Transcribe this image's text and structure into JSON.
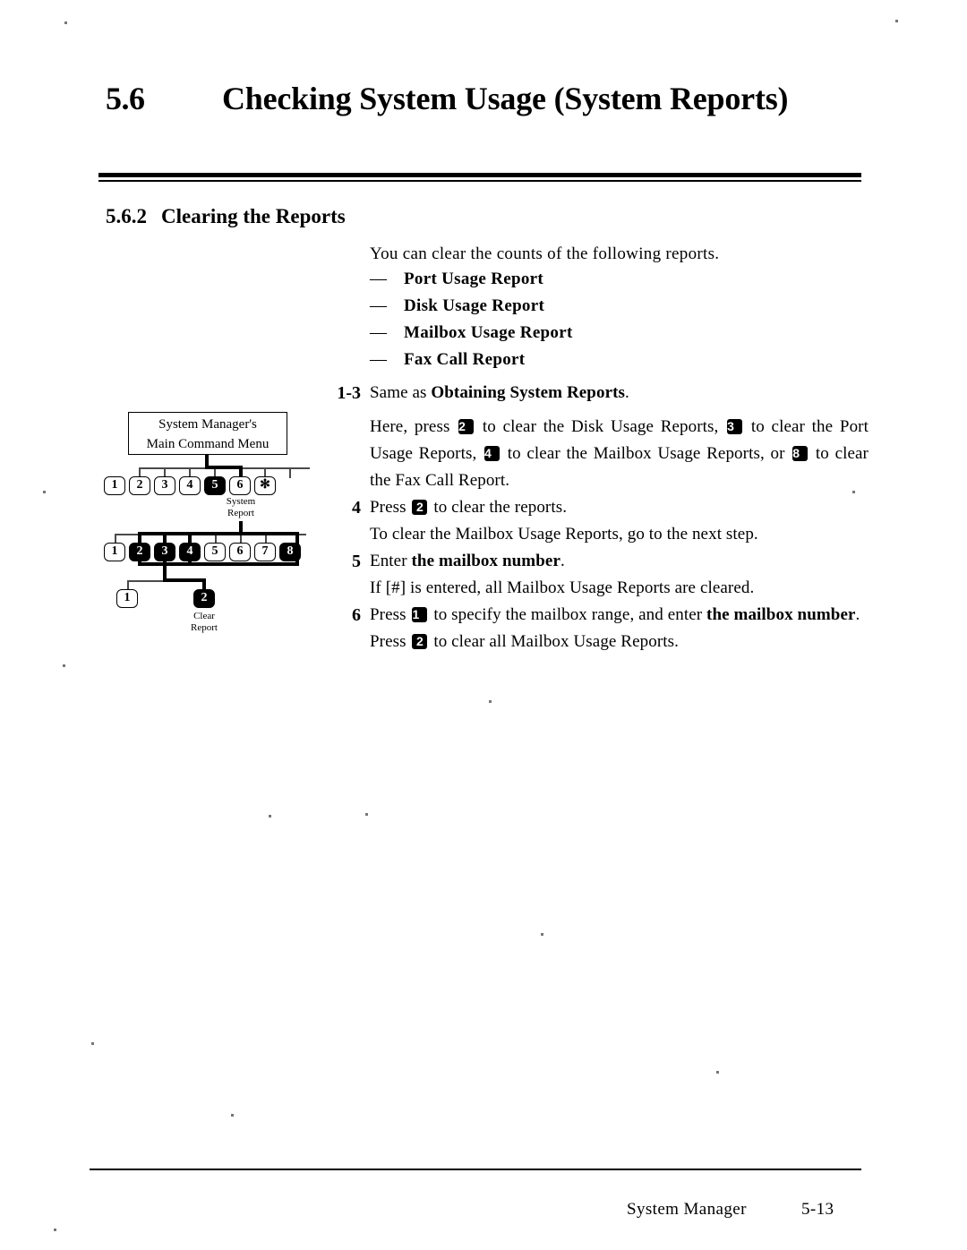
{
  "chapter": {
    "number": "5.6",
    "title": "Checking System Usage (System Reports)"
  },
  "section": {
    "number": "5.6.2",
    "title": "Clearing the Reports"
  },
  "intro": "You can clear the counts of the following reports.",
  "report_list": {
    "dash": "—",
    "items": [
      "Port Usage Report",
      "Disk Usage Report",
      "Mailbox Usage Report",
      "Fax Call Report"
    ]
  },
  "steps": [
    {
      "number": "1-3",
      "line1_prefix": "Same as ",
      "line1_bold": "Obtaining System Reports",
      "line1_suffix": ".",
      "para_parts": [
        {
          "t": "Here, press "
        },
        {
          "key": "2"
        },
        {
          "t": " to clear the Disk Usage Reports, "
        },
        {
          "key": "3"
        },
        {
          "t": " to clear the Port Usage Reports, "
        },
        {
          "key": "4"
        },
        {
          "t": " to clear the Mailbox Usage Reports, or "
        },
        {
          "key": "8"
        },
        {
          "t": " to clear the Fax Call Report."
        }
      ]
    },
    {
      "number": "4",
      "parts": [
        {
          "t": "Press "
        },
        {
          "key": "2"
        },
        {
          "t": " to clear the reports."
        }
      ],
      "sub": "To clear the Mailbox Usage Reports, go to the next step."
    },
    {
      "number": "5",
      "parts": [
        {
          "t": "Enter "
        },
        {
          "b": "the mailbox number"
        },
        {
          "t": "."
        }
      ],
      "sub": "If [#] is entered, all Mailbox Usage Reports are cleared."
    },
    {
      "number": "6",
      "parts": [
        {
          "t": "Press "
        },
        {
          "key": "1"
        },
        {
          "t": " to specify the mailbox range, and enter "
        },
        {
          "b": "the mailbox number"
        },
        {
          "t": "."
        }
      ]
    },
    {
      "number": "",
      "parts": [
        {
          "t": "Press "
        },
        {
          "key": "2"
        },
        {
          "t": " to clear all Mailbox Usage Reports."
        }
      ]
    }
  ],
  "diagram": {
    "menu_box_line1": "System Manager's",
    "menu_box_line2": "Main Command Menu",
    "row1": {
      "keys": [
        "1",
        "2",
        "3",
        "4",
        "5",
        "6",
        "✻"
      ],
      "selected": [
        "5"
      ],
      "caption_line1": "System",
      "caption_line2": "Report"
    },
    "row2": {
      "keys": [
        "1",
        "2",
        "3",
        "4",
        "5",
        "6",
        "7",
        "8"
      ],
      "selected": [
        "2",
        "3",
        "4",
        "8"
      ]
    },
    "row3": {
      "keys": [
        "1",
        "2"
      ],
      "selected": [
        "2"
      ],
      "caption_line1": "Clear",
      "caption_line2": "Report"
    }
  },
  "footer": {
    "name": "System Manager",
    "page": "5-13"
  },
  "colors": {
    "ink": "#000000",
    "paper": "#ffffff",
    "faint_line": "#4a4a4a"
  }
}
